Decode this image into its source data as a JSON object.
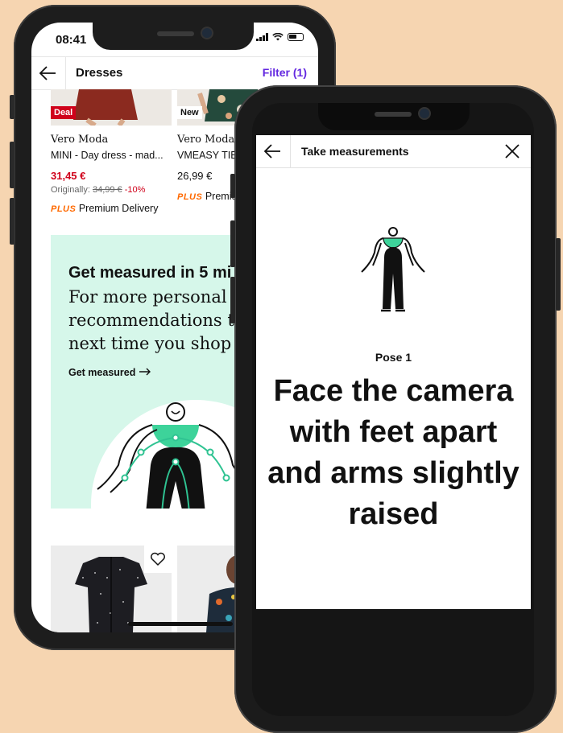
{
  "colors": {
    "background": "#f6d5b1",
    "accent_purple": "#6328e0",
    "sale_red": "#d0021b",
    "plus_orange": "#ff6900",
    "promo_mint": "#d6f7ea",
    "figure_teal": "#2fc392"
  },
  "phone_back": {
    "status": {
      "time": "08:41"
    },
    "header": {
      "title": "Dresses",
      "filter": "Filter (1)",
      "back_icon": "arrow-left-icon"
    },
    "products": [
      {
        "tag": "Deal",
        "brand": "Vero Moda",
        "name": "MINI - Day dress - mad...",
        "price": "31,45 €",
        "original_label": "Originally:",
        "original_price": "34,99 €",
        "discount": "-10%",
        "plus_logo": "PLUS",
        "delivery": "Premium Delivery"
      },
      {
        "tag": "New",
        "brand": "Vero Moda",
        "name": "VMEASY TIE",
        "price": "26,99 €",
        "plus_logo": "PLUS",
        "delivery": "Premium"
      }
    ],
    "promo": {
      "heading": "Get measured in 5 mi",
      "body_line1": "For more personal siz",
      "body_line2": "recommendations th",
      "body_line3": "next time you shop",
      "link": "Get measured",
      "link_icon": "arrow-right-icon"
    },
    "bottom_products": [
      {
        "heart_icon": "heart-icon"
      },
      {}
    ]
  },
  "phone_front": {
    "header": {
      "title": "Take measurements",
      "back_icon": "arrow-left-icon",
      "close_icon": "close-icon"
    },
    "pose_label": "Pose 1",
    "instruction": "Face the camera with feet apart and arms slightly raised"
  }
}
